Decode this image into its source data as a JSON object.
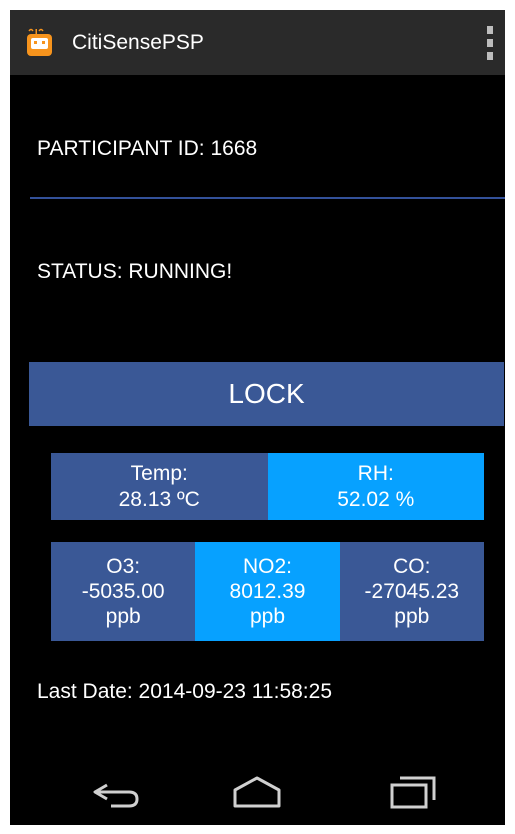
{
  "app": {
    "title": "CitiSensePSP",
    "icon": "robot-app-icon",
    "menu_icon": "overflow-menu-icon"
  },
  "participant": {
    "text": "PARTICIPANT ID: 1668"
  },
  "status": {
    "text": "STATUS: RUNNING!"
  },
  "lock_button": {
    "label": "LOCK"
  },
  "sensors": {
    "temp": {
      "label": "Temp:",
      "value": "28.13 ºC"
    },
    "rh": {
      "label": "RH:",
      "value": "52.02 %"
    },
    "o3": {
      "label": "O3:",
      "value": "-5035.00",
      "unit": "ppb"
    },
    "no2": {
      "label": "NO2:",
      "value": "8012.39",
      "unit": "ppb"
    },
    "co": {
      "label": "CO:",
      "value": "-27045.23",
      "unit": "ppb"
    }
  },
  "last_date": {
    "text": "Last Date: 2014-09-23 11:58:25"
  },
  "navigation": {
    "back_icon": "back-icon",
    "home_icon": "home-icon",
    "recent_icon": "recent-apps-icon"
  },
  "colors": {
    "dark_blue": "#3a5896",
    "light_blue": "#07a1ff",
    "action_bar": "#2a2a2a",
    "background": "#000000"
  }
}
